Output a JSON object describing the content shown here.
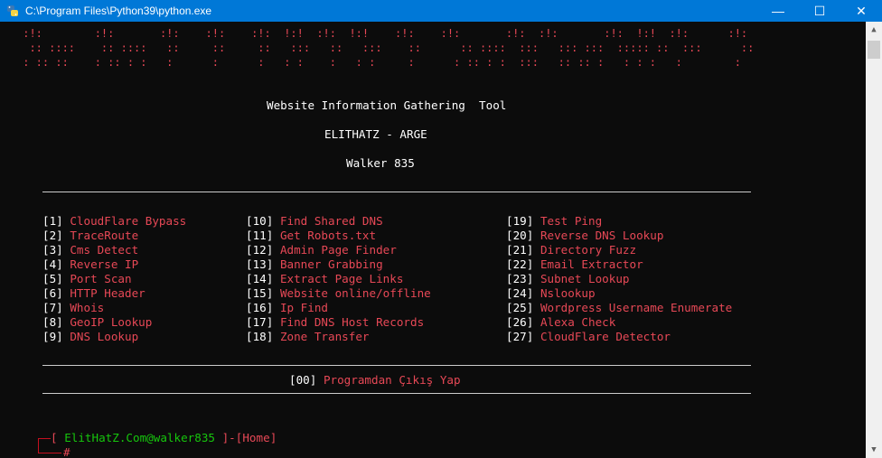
{
  "window": {
    "title": "C:\\Program Files\\Python39\\python.exe",
    "minimize_glyph": "—",
    "maximize_glyph": "☐",
    "close_glyph": "✕"
  },
  "banner": [
    " :!:        :!:       :!:    :!:    :!:  !:!  :!:  !:!    :!:    :!:       :!:  :!:       :!:  !:!  :!:      :!:",
    "  :: ::::    :: ::::   ::     ::     ::   :::   ::   :::    ::      :: ::::  :::   ::: :::  ::::: ::  :::      ::",
    " : :: ::    : :: : :   :      :      :   : :    :   : :     :      : :: : :  :::   :: :: :   : : :   :        :"
  ],
  "header": {
    "title": "Website Information Gathering  Tool",
    "subtitle": "ELITHATZ - ARGE",
    "author": "Walker 835"
  },
  "menu": {
    "col1": [
      {
        "num": "[1]",
        "label": "CloudFlare Bypass"
      },
      {
        "num": "[2]",
        "label": "TraceRoute"
      },
      {
        "num": "[3]",
        "label": "Cms Detect"
      },
      {
        "num": "[4]",
        "label": "Reverse IP"
      },
      {
        "num": "[5]",
        "label": "Port Scan"
      },
      {
        "num": "[6]",
        "label": "HTTP Header"
      },
      {
        "num": "[7]",
        "label": "Whois"
      },
      {
        "num": "[8]",
        "label": "GeoIP Lookup"
      },
      {
        "num": "[9]",
        "label": "DNS Lookup"
      }
    ],
    "col2": [
      {
        "num": "[10]",
        "label": "Find Shared DNS"
      },
      {
        "num": "[11]",
        "label": "Get Robots.txt"
      },
      {
        "num": "[12]",
        "label": "Admin Page Finder"
      },
      {
        "num": "[13]",
        "label": "Banner Grabbing"
      },
      {
        "num": "[14]",
        "label": "Extract Page Links"
      },
      {
        "num": "[15]",
        "label": "Website online/offline"
      },
      {
        "num": "[16]",
        "label": "Ip Find"
      },
      {
        "num": "[17]",
        "label": "Find DNS Host Records"
      },
      {
        "num": "[18]",
        "label": "Zone Transfer"
      }
    ],
    "col3": [
      {
        "num": "[19]",
        "label": "Test Ping"
      },
      {
        "num": "[20]",
        "label": "Reverse DNS Lookup"
      },
      {
        "num": "[21]",
        "label": "Directory Fuzz"
      },
      {
        "num": "[22]",
        "label": "Email Extractor"
      },
      {
        "num": "[23]",
        "label": "Subnet Lookup"
      },
      {
        "num": "[24]",
        "label": "Nslookup"
      },
      {
        "num": "[25]",
        "label": "Wordpress Username Enumerate"
      },
      {
        "num": "[26]",
        "label": "Alexa Check"
      },
      {
        "num": "[27]",
        "label": "CloudFlare Detector"
      }
    ]
  },
  "exit": {
    "num": "[00]",
    "label": "Programdan Çıkış Yap"
  },
  "prompt": {
    "open_bracket": "[",
    "user": "ElitHatZ.Com@walker835",
    "close_sep": "]-[",
    "location": "Home",
    "end_bracket": "]",
    "symbol": "#"
  },
  "colors": {
    "titlebar": "#0078d7",
    "background": "#0c0c0c",
    "red": "#e74856",
    "green": "#16c60c",
    "text": "#cccccc"
  }
}
